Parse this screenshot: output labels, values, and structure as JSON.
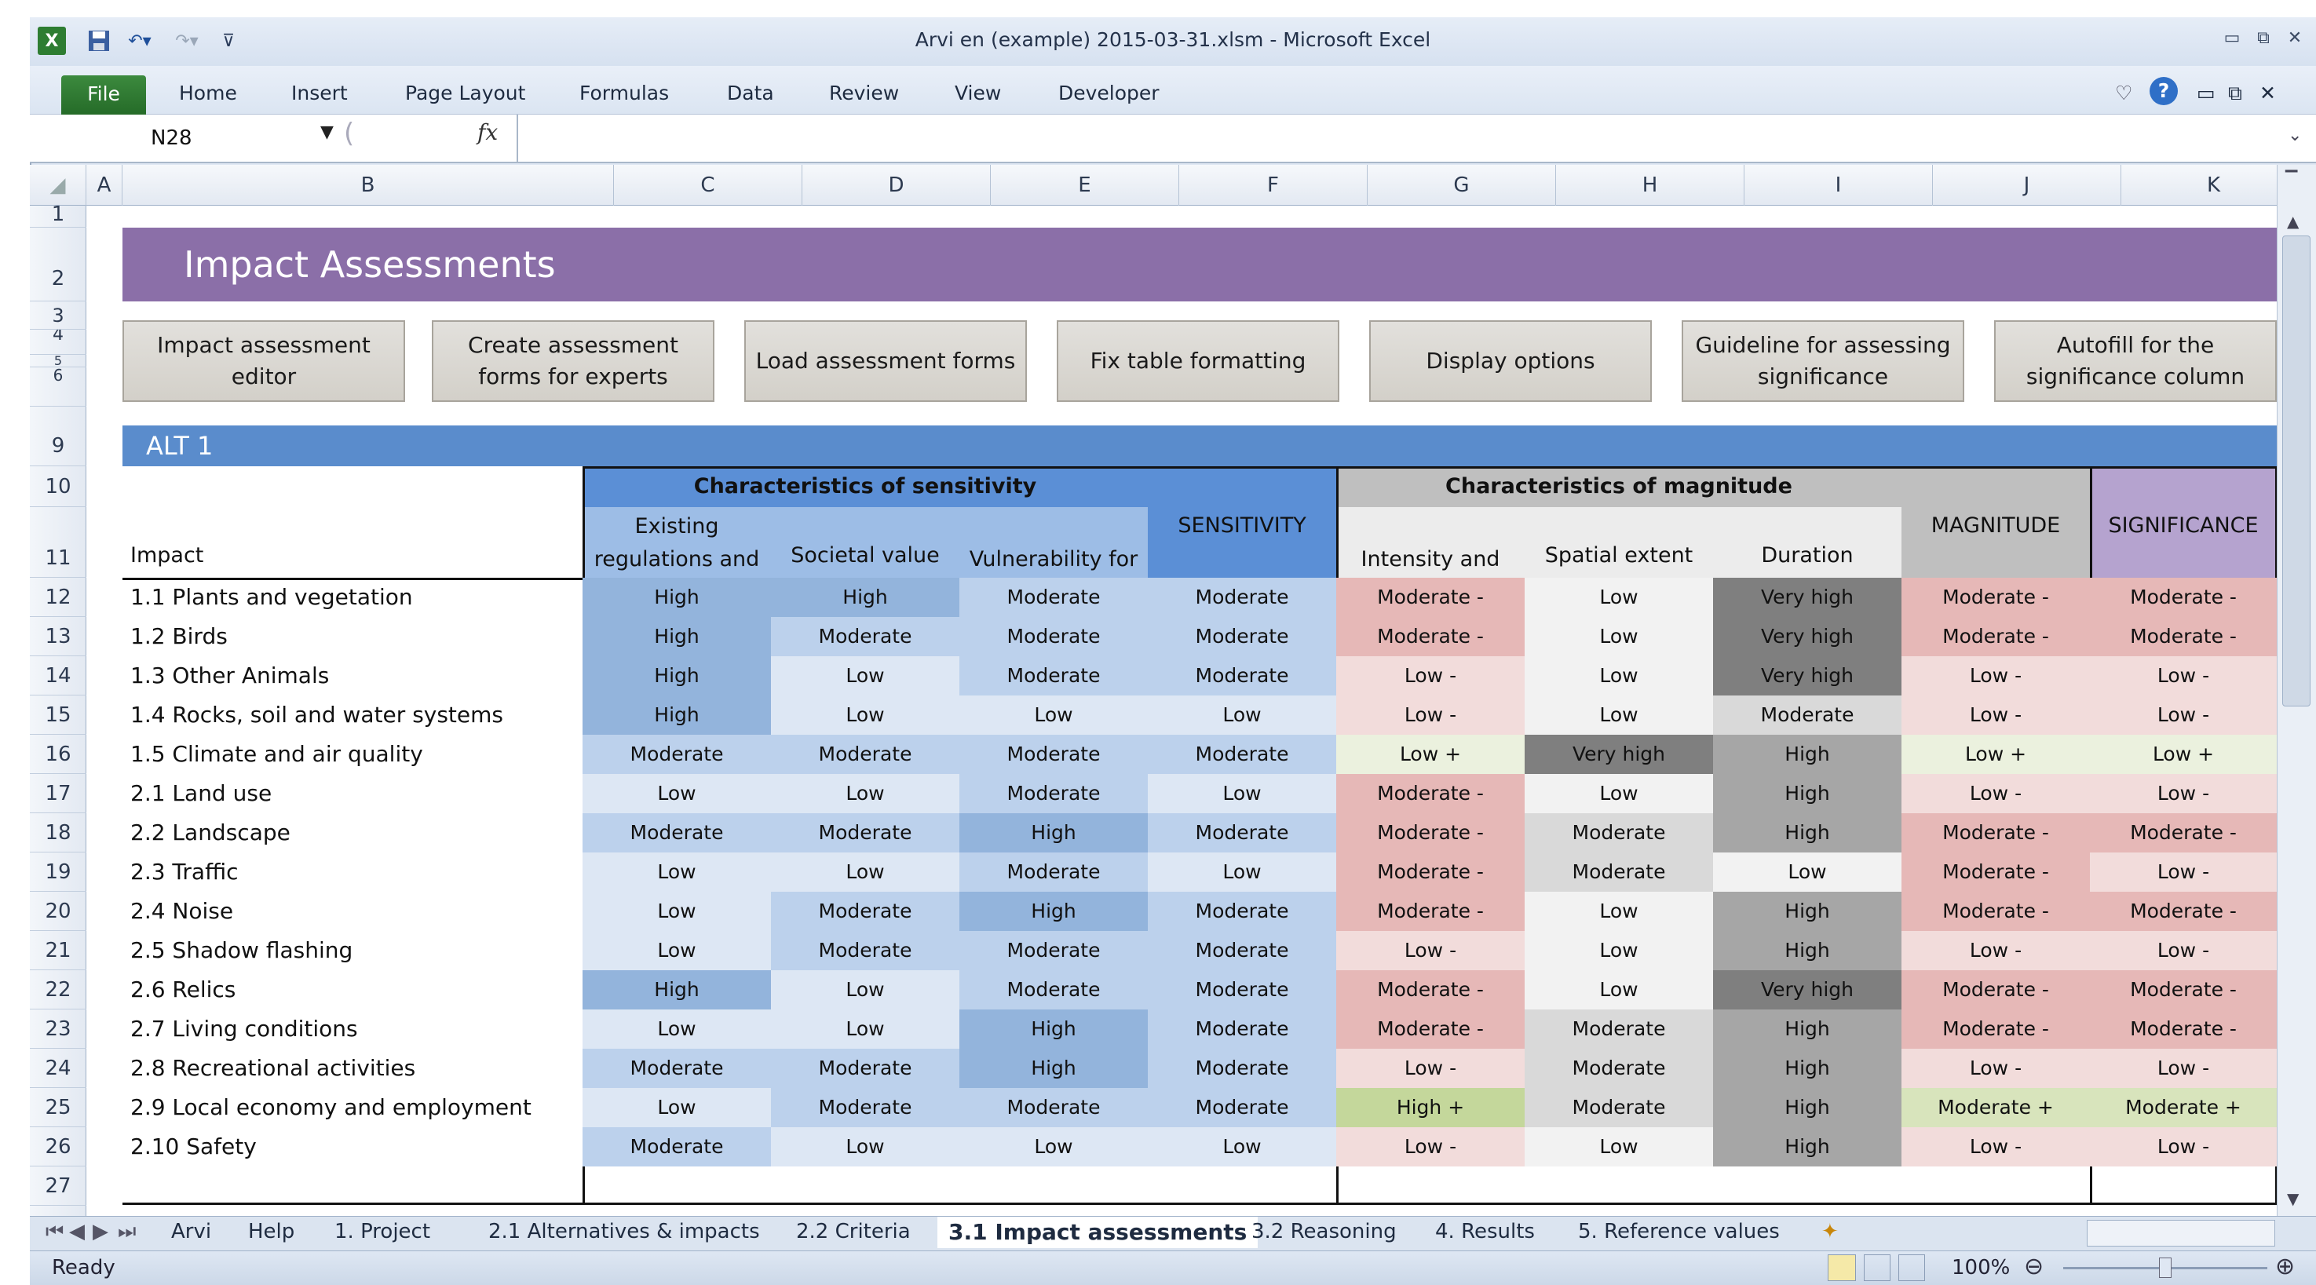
{
  "window": {
    "title": "Arvi en (example) 2015-03-31.xlsm  -  Microsoft Excel"
  },
  "ribbon": {
    "tabs": [
      "File",
      "Home",
      "Insert",
      "Page Layout",
      "Formulas",
      "Data",
      "Review",
      "View",
      "Developer"
    ]
  },
  "formula_bar": {
    "name_box": "N28",
    "fx": "fx",
    "value": ""
  },
  "columns": [
    "A",
    "B",
    "C",
    "D",
    "E",
    "F",
    "G",
    "H",
    "I",
    "J",
    "K"
  ],
  "rows": [
    "1",
    "2",
    "3",
    "4",
    "5",
    "6",
    "9",
    "10",
    "11",
    "12",
    "13",
    "14",
    "15",
    "16",
    "17",
    "18",
    "19",
    "20",
    "21",
    "22",
    "23",
    "24",
    "25",
    "26",
    "27"
  ],
  "sheet": {
    "title": "Impact Assessments",
    "buttons": [
      "Impact assessment editor",
      "Create assessment forms for experts",
      "Load assessment forms",
      "Fix table formatting",
      "Display options",
      "Guideline for assessing significance",
      "Autofill for the significance column"
    ],
    "alt_label": "ALT 1",
    "group_sensitivity": "Characteristics of sensitivity",
    "group_magnitude": "Characteristics of magnitude",
    "col_impact": "Impact",
    "col_existing": "Existing regulations and guidance",
    "col_societal": "Societal value",
    "col_vulnerability": "Vulnerability for changes",
    "col_sensitivity": "SENSITIVITY",
    "col_intensity": "Intensity and direction",
    "col_spatial": "Spatial extent",
    "col_duration": "Duration",
    "col_magnitude": "MAGNITUDE",
    "col_significance": "SIGNIFICANCE",
    "rows": [
      {
        "impact": "1.1 Plants and vegetation",
        "c": "High",
        "d": "High",
        "e": "Moderate",
        "f": "Moderate",
        "g": "Moderate -",
        "h": "Low",
        "i": "Very high",
        "j": "Moderate -",
        "k": "Moderate -"
      },
      {
        "impact": "1.2 Birds",
        "c": "High",
        "d": "Moderate",
        "e": "Moderate",
        "f": "Moderate",
        "g": "Moderate -",
        "h": "Low",
        "i": "Very high",
        "j": "Moderate -",
        "k": "Moderate -"
      },
      {
        "impact": "1.3 Other Animals",
        "c": "High",
        "d": "Low",
        "e": "Moderate",
        "f": "Moderate",
        "g": "Low -",
        "h": "Low",
        "i": "Very high",
        "j": "Low -",
        "k": "Low -"
      },
      {
        "impact": "1.4 Rocks, soil and water systems",
        "c": "High",
        "d": "Low",
        "e": "Low",
        "f": "Low",
        "g": "Low -",
        "h": "Low",
        "i": "Moderate",
        "j": "Low -",
        "k": "Low -"
      },
      {
        "impact": "1.5 Climate and air quality",
        "c": "Moderate",
        "d": "Moderate",
        "e": "Moderate",
        "f": "Moderate",
        "g": "Low +",
        "h": "Very high",
        "i": "High",
        "j": "Low +",
        "k": "Low +"
      },
      {
        "impact": "2.1 Land use",
        "c": "Low",
        "d": "Low",
        "e": "Moderate",
        "f": "Low",
        "g": "Moderate -",
        "h": "Low",
        "i": "High",
        "j": "Low -",
        "k": "Low -"
      },
      {
        "impact": "2.2 Landscape",
        "c": "Moderate",
        "d": "Moderate",
        "e": "High",
        "f": "Moderate",
        "g": "Moderate -",
        "h": "Moderate",
        "i": "High",
        "j": "Moderate -",
        "k": "Moderate -"
      },
      {
        "impact": "2.3 Traffic",
        "c": "Low",
        "d": "Low",
        "e": "Moderate",
        "f": "Low",
        "g": "Moderate -",
        "h": "Moderate",
        "i": "Low",
        "j": "Moderate -",
        "k": "Low -"
      },
      {
        "impact": "2.4 Noise",
        "c": "Low",
        "d": "Moderate",
        "e": "High",
        "f": "Moderate",
        "g": "Moderate -",
        "h": "Low",
        "i": "High",
        "j": "Moderate -",
        "k": "Moderate -"
      },
      {
        "impact": "2.5 Shadow flashing",
        "c": "Low",
        "d": "Moderate",
        "e": "Moderate",
        "f": "Moderate",
        "g": "Low -",
        "h": "Low",
        "i": "High",
        "j": "Low -",
        "k": "Low -"
      },
      {
        "impact": "2.6 Relics",
        "c": "High",
        "d": "Low",
        "e": "Moderate",
        "f": "Moderate",
        "g": "Moderate -",
        "h": "Low",
        "i": "Very high",
        "j": "Moderate -",
        "k": "Moderate -"
      },
      {
        "impact": "2.7 Living conditions",
        "c": "Low",
        "d": "Low",
        "e": "High",
        "f": "Moderate",
        "g": "Moderate -",
        "h": "Moderate",
        "i": "High",
        "j": "Moderate -",
        "k": "Moderate -"
      },
      {
        "impact": "2.8 Recreational activities",
        "c": "Moderate",
        "d": "Moderate",
        "e": "High",
        "f": "Moderate",
        "g": "Low -",
        "h": "Moderate",
        "i": "High",
        "j": "Low -",
        "k": "Low -"
      },
      {
        "impact": "2.9 Local economy and employment",
        "c": "Low",
        "d": "Moderate",
        "e": "Moderate",
        "f": "Moderate",
        "g": "High +",
        "h": "Moderate",
        "i": "High",
        "j": "Moderate +",
        "k": "Moderate +"
      },
      {
        "impact": "2.10 Safety",
        "c": "Moderate",
        "d": "Low",
        "e": "Low",
        "f": "Low",
        "g": "Low -",
        "h": "Low",
        "i": "High",
        "j": "Low -",
        "k": "Low -"
      }
    ]
  },
  "sheet_tabs": [
    "Arvi",
    "Help",
    "1. Project",
    "2.1 Alternatives & impacts",
    "2.2 Criteria",
    "3.1 Impact assessments",
    "3.2 Reasoning",
    "4. Results",
    "5. Reference values"
  ],
  "active_sheet": "3.1 Impact assessments",
  "status": {
    "ready": "Ready",
    "zoom": "100%"
  },
  "colors": {
    "banner": "#8b6fa8",
    "alt_bar": "#5a8ccc",
    "file_tab": "#2f7a32"
  }
}
